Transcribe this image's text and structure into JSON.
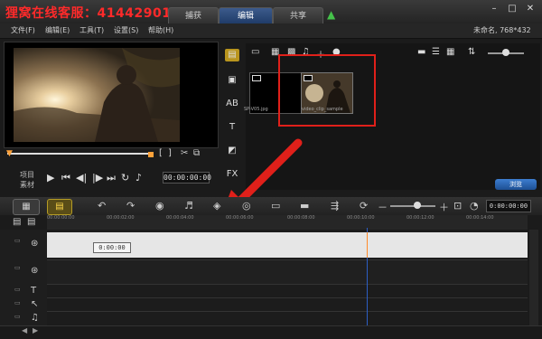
{
  "title_bar": {
    "brand": "狸窝在线客服：41442901",
    "tabs": [
      "捕获",
      "编辑",
      "共享"
    ]
  },
  "menu": {
    "items": [
      "文件(F)",
      "编辑(E)",
      "工具(T)",
      "设置(S)",
      "帮助(H)"
    ],
    "resolution": "未命名, 768*432"
  },
  "player": {
    "project_label": "项目",
    "clip_label": "素材",
    "timecode": "00:00:00:00"
  },
  "library": {
    "thumb_a_caption": "SP-V05.jpg",
    "thumb_b_caption": "video_clip_sample",
    "browse_label": "浏览"
  },
  "timeline": {
    "timecode": "0:00:00:00",
    "clip_timecode": "0:00:00",
    "ruler_labels": [
      "00:00:00:00",
      "00:00:02:00",
      "00:00:04:00",
      "00:00:06:00",
      "00:00:08:00",
      "00:00:10:00",
      "00:00:12:00",
      "00:00:14:00",
      "00:00:16:00"
    ]
  },
  "colors": {
    "annotation": "#e0201a",
    "brand": "#ff2a2a",
    "accent": "#2c5ec5"
  }
}
